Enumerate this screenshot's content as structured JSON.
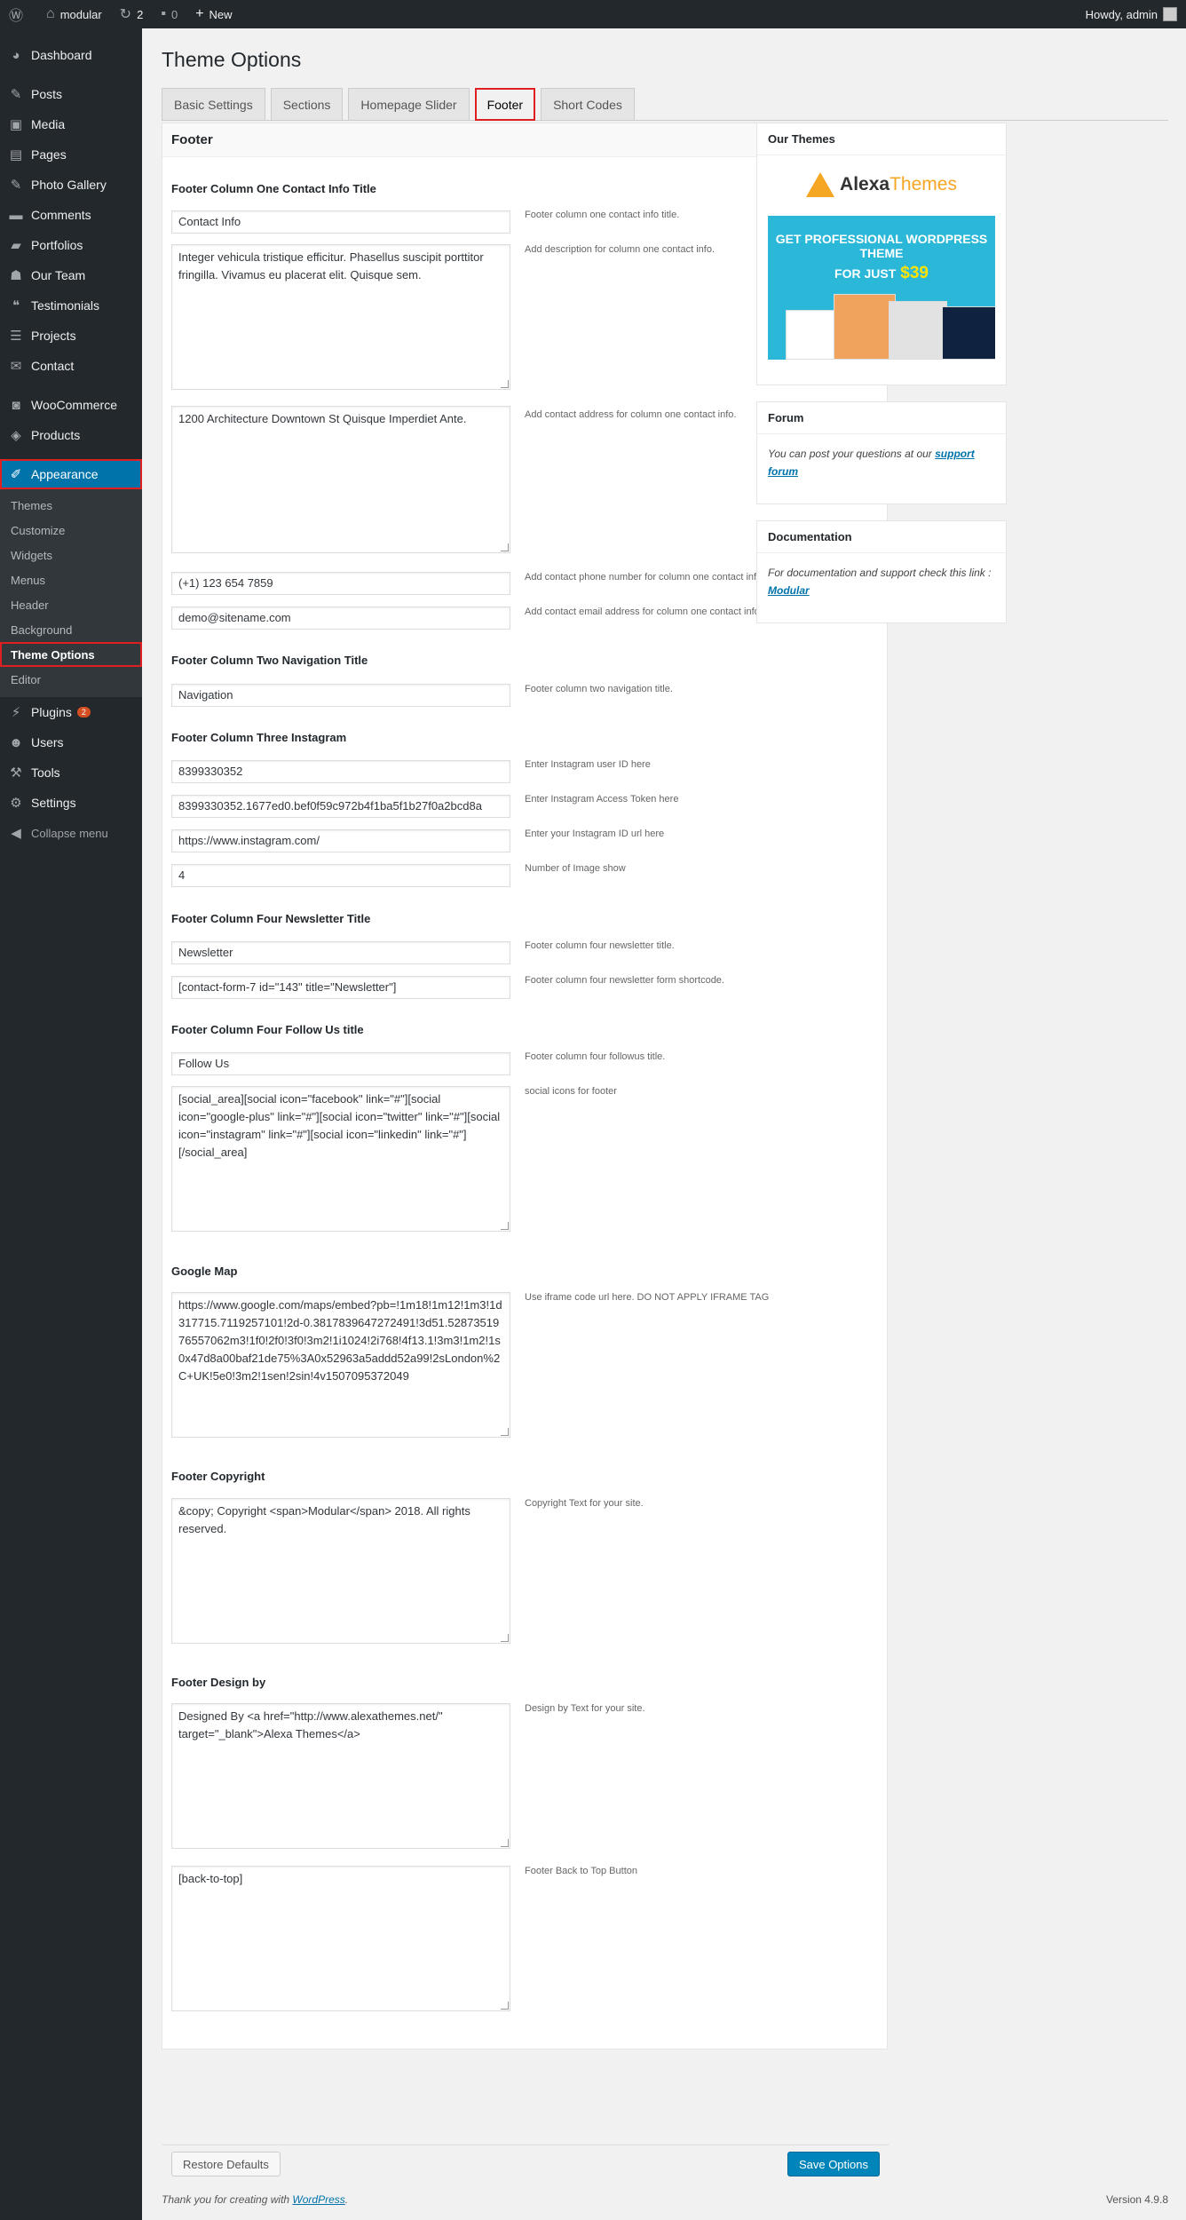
{
  "adminbar": {
    "site": "modular",
    "updates": "2",
    "comments": "0",
    "new": "New",
    "howdy": "Howdy, admin"
  },
  "sidebar": {
    "items": [
      {
        "label": "Dashboard",
        "icon": "dashboard-icon"
      },
      {
        "label": "Posts",
        "icon": "pin-icon"
      },
      {
        "label": "Media",
        "icon": "media-icon"
      },
      {
        "label": "Pages",
        "icon": "pages-icon"
      },
      {
        "label": "Photo Gallery",
        "icon": "pin-icon"
      },
      {
        "label": "Comments",
        "icon": "comment-icon"
      },
      {
        "label": "Portfolios",
        "icon": "folder-icon"
      },
      {
        "label": "Our Team",
        "icon": "team-icon"
      },
      {
        "label": "Testimonials",
        "icon": "quote-icon"
      },
      {
        "label": "Projects",
        "icon": "list-icon"
      },
      {
        "label": "Contact",
        "icon": "mail-icon"
      },
      {
        "label": "WooCommerce",
        "icon": "woo-icon"
      },
      {
        "label": "Products",
        "icon": "archive-icon"
      },
      {
        "label": "Appearance",
        "icon": "brush-icon"
      }
    ],
    "submenu": [
      "Themes",
      "Customize",
      "Widgets",
      "Menus",
      "Header",
      "Background",
      "Theme Options",
      "Editor"
    ],
    "lower": [
      {
        "label": "Plugins",
        "icon": "plugin-icon",
        "badge": "2"
      },
      {
        "label": "Users",
        "icon": "user-icon"
      },
      {
        "label": "Tools",
        "icon": "wrench-icon"
      },
      {
        "label": "Settings",
        "icon": "settings-icon"
      }
    ],
    "collapse": "Collapse menu"
  },
  "page": {
    "title": "Theme Options",
    "tabs": [
      "Basic Settings",
      "Sections",
      "Homepage Slider",
      "Footer",
      "Short Codes"
    ],
    "active_tab": "Footer"
  },
  "panel": {
    "heading": "Footer",
    "sections": [
      "Footer Column One Contact Info Title",
      "Footer Column Two Navigation Title",
      "Footer Column Three Instagram",
      "Footer Column Four Newsletter Title",
      "Footer Column Four Follow Us title",
      "Google Map",
      "Footer Copyright",
      "Footer Design by"
    ],
    "fields": [
      {
        "value": "Contact Info",
        "desc": "Footer column one contact info title."
      },
      {
        "value": "Integer vehicula tristique efficitur. Phasellus suscipit porttitor fringilla. Vivamus eu placerat elit. Quisque sem.",
        "desc": "Add description for column one contact info."
      },
      {
        "value": "1200 Architecture Downtown St Quisque Imperdiet Ante.",
        "desc": "Add contact address for column one contact info."
      },
      {
        "value": "(+1) 123 654 7859",
        "desc": "Add contact phone number for column one contact info."
      },
      {
        "value": "demo@sitename.com",
        "desc": "Add contact email address for column one contact info."
      },
      {
        "value": "Navigation",
        "desc": "Footer column two navigation title."
      },
      {
        "value": "8399330352",
        "desc": "Enter Instagram user ID here"
      },
      {
        "value": "8399330352.1677ed0.bef0f59c972b4f1ba5f1b27f0a2bcd8a",
        "desc": "Enter Instagram Access Token here"
      },
      {
        "value": "https://www.instagram.com/",
        "desc": "Enter your Instagram ID url here"
      },
      {
        "value": "4",
        "desc": "Number of Image show"
      },
      {
        "value": "Newsletter",
        "desc": "Footer column four newsletter title."
      },
      {
        "value": "[contact-form-7 id=\"143\" title=\"Newsletter\"]",
        "desc": "Footer column four newsletter form shortcode."
      },
      {
        "value": "Follow Us",
        "desc": "Footer column four followus title."
      },
      {
        "value": "[social_area][social icon=\"facebook\" link=\"#\"][social icon=\"google-plus\" link=\"#\"][social icon=\"twitter\" link=\"#\"][social icon=\"instagram\" link=\"#\"][social icon=\"linkedin\" link=\"#\"][/social_area]",
        "desc": "social icons for footer"
      },
      {
        "value": "https://www.google.com/maps/embed?pb=!1m18!1m12!1m3!1d317715.7119257101!2d-0.3817839647272491!3d51.5287351976557062m3!1f0!2f0!3f0!3m2!1i1024!2i768!4f13.1!3m3!1m2!1s0x47d8a00baf21de75%3A0x52963a5addd52a99!2sLondon%2C+UK!5e0!3m2!1sen!2sin!4v1507095372049",
        "desc": "Use iframe code url here. DO NOT APPLY IFRAME TAG"
      },
      {
        "value": "&copy; Copyright <span>Modular</span> 2018. All rights reserved.",
        "desc": "Copyright Text for your site."
      },
      {
        "value": "Designed By <a href=\"http://www.alexathemes.net/\" target=\"_blank\">Alexa Themes</a>",
        "desc": "Design by Text for your site."
      },
      {
        "value": "[back-to-top]",
        "desc": "Footer Back to Top Button"
      }
    ],
    "restore": "Restore Defaults",
    "save": "Save Options"
  },
  "widgets": {
    "themes": {
      "title": "Our Themes",
      "logo_a": "Alexa",
      "logo_b": "Themes",
      "promo_line1": "GET PROFESSIONAL WORDPRESS THEME",
      "promo_line2": "FOR JUST",
      "promo_price": "$39"
    },
    "forum": {
      "title": "Forum",
      "text": "You can post your questions at our ",
      "link": "support forum"
    },
    "docs": {
      "title": "Documentation",
      "text": "For documentation and support check this link : ",
      "link": "Modular"
    }
  },
  "footer": {
    "thanks": "Thank you for creating with ",
    "wp": "WordPress",
    "version": "Version 4.9.8"
  }
}
